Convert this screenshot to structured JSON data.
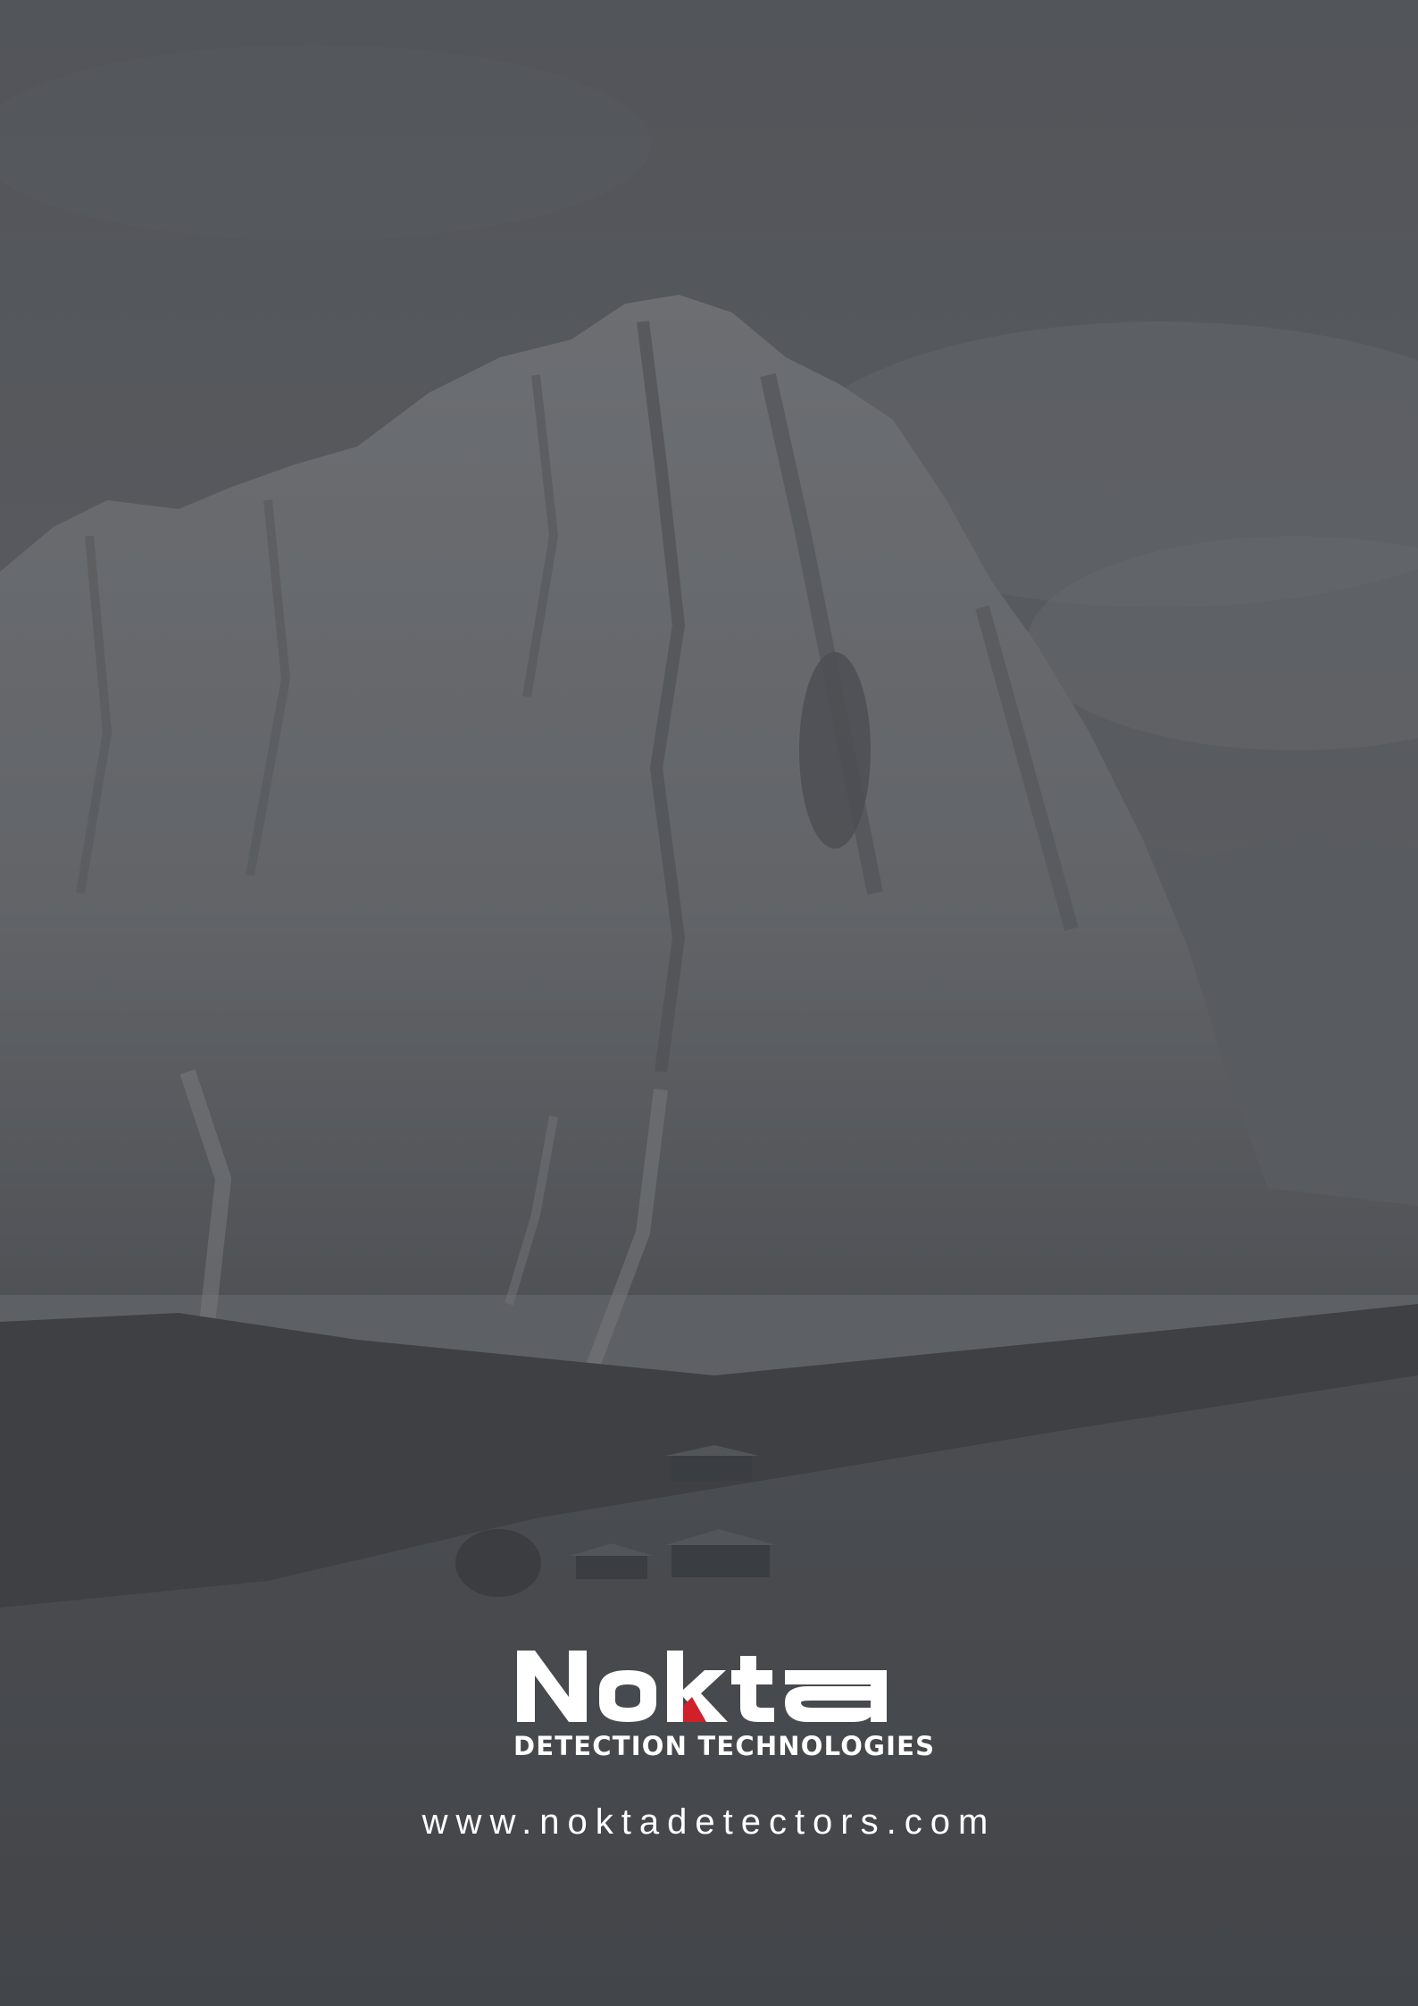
{
  "brand": {
    "name": "Nokta",
    "tagline": "DETECTION TECHNOLOGIES",
    "accent_color": "#d0202a",
    "text_color": "#ffffff"
  },
  "website": {
    "url": "www.noktadetectors.com"
  },
  "background": {
    "description_icon": "mountain-landscape-image",
    "tint": "#4f5155"
  }
}
